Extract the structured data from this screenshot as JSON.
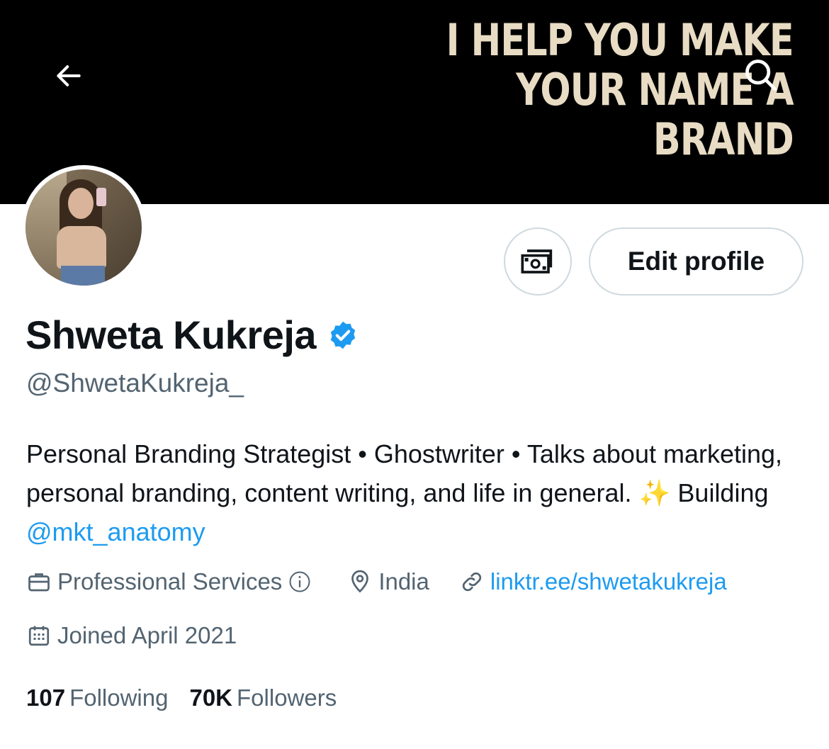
{
  "banner": {
    "lines": [
      "I HELP YOU MAKE",
      "YOUR NAME A",
      "BRAND"
    ]
  },
  "icons": {
    "back": "arrow-left-icon",
    "search": "search-icon",
    "money": "money-icon",
    "verified": "verified-badge-icon",
    "briefcase": "briefcase-icon",
    "location": "location-pin-icon",
    "link": "link-icon",
    "calendar": "calendar-icon",
    "info": "info-circle-icon"
  },
  "profile": {
    "display_name": "Shweta Kukreja",
    "handle": "@ShwetaKukreja_",
    "bio_text": "Personal Branding Strategist • Ghostwriter • Talks about marketing, personal branding, content writing, and life in general.",
    "bio_sparkle": "✨",
    "bio_building": "Building",
    "bio_mention": "@mkt_anatomy",
    "category": "Professional Services",
    "location": "India",
    "website": "linktr.ee/shwetakukreja",
    "joined": "Joined April 2021"
  },
  "actions": {
    "edit_label": "Edit profile"
  },
  "stats": {
    "following_count": "107",
    "following_label": "Following",
    "followers_count": "70K",
    "followers_label": "Followers"
  },
  "colors": {
    "accent": "#1d9bf0",
    "text_primary": "#0f1419",
    "text_secondary": "#536471",
    "banner_bg": "#000000",
    "banner_text": "#e8dcc4"
  }
}
